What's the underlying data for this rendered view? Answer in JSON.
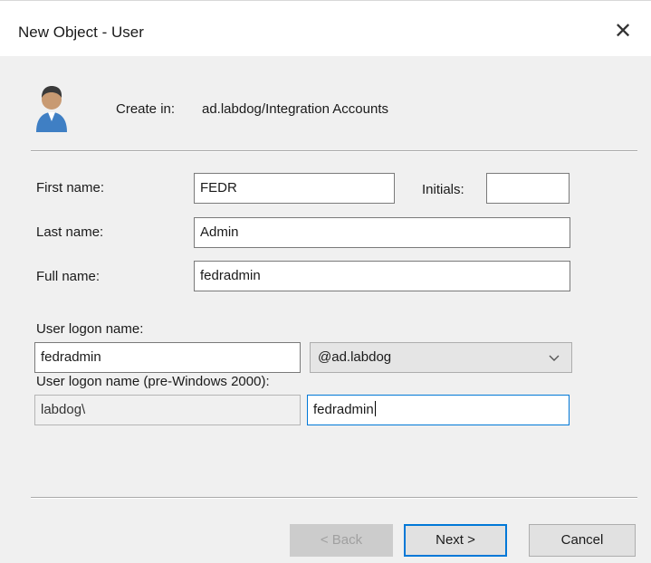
{
  "window": {
    "title": "New Object - User",
    "close_glyph": "✕"
  },
  "header": {
    "create_in_label": "Create in:",
    "create_in_value": "ad.labdog/Integration Accounts",
    "icon": "user-icon"
  },
  "form": {
    "first_name": {
      "label": "First name:",
      "value": "FEDR"
    },
    "initials": {
      "label": "Initials:",
      "value": ""
    },
    "last_name": {
      "label": "Last name:",
      "value": "Admin"
    },
    "full_name": {
      "label": "Full name:",
      "value": "fedradmin"
    },
    "logon": {
      "label": "User logon name:",
      "value": "fedradmin",
      "domain": "@ad.labdog"
    },
    "pre2000": {
      "label": "User logon name (pre-Windows 2000):",
      "domain_prefix": "labdog\\",
      "value": "fedradmin"
    }
  },
  "buttons": {
    "back": "< Back",
    "next": "Next >",
    "cancel": "Cancel"
  },
  "colors": {
    "focus": "#0078d7",
    "dialog_bg": "#f0f0f0"
  }
}
